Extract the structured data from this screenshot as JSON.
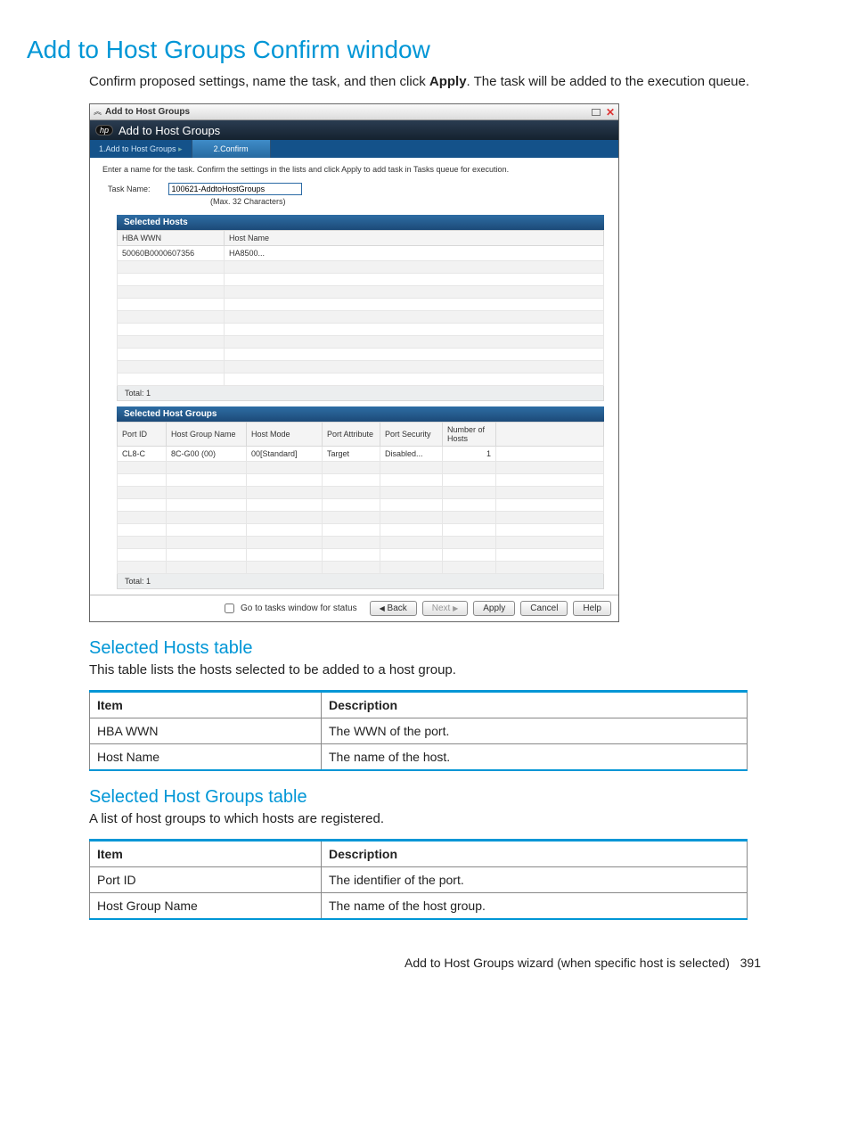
{
  "heading": "Add to Host Groups Confirm window",
  "intro_pre": "Confirm proposed settings, name the task, and then click ",
  "intro_bold": "Apply",
  "intro_post": ". The task will be added to the execution queue.",
  "win": {
    "outerTitle": "Add to Host Groups",
    "innerTitle": "Add to Host Groups",
    "step1": "1.Add to Host Groups",
    "step2": "2.Confirm",
    "instruction": "Enter a name for the task. Confirm the settings in the lists and click Apply to add task in Tasks queue for execution.",
    "taskLabel": "Task Name:",
    "taskValue": "100621-AddtoHostGroups",
    "taskHint": "(Max. 32 Characters)",
    "hostsPanel": "Selected Hosts",
    "hostsCols": [
      "HBA WWN",
      "Host Name"
    ],
    "hostsRow": [
      "50060B0000607356",
      "HA8500..."
    ],
    "hostsTotal": "Total: 1",
    "groupsPanel": "Selected Host Groups",
    "groupsCols": [
      "Port ID",
      "Host Group Name",
      "Host Mode",
      "Port Attribute",
      "Port Security",
      "Number of Hosts"
    ],
    "groupsRow": [
      "CL8-C",
      "8C-G00 (00)",
      "00[Standard]",
      "Target",
      "Disabled...",
      "1"
    ],
    "groupsTotal": "Total: 1",
    "cbLabel": "Go to tasks window for status",
    "btnBack": "Back",
    "btnNext": "Next",
    "btnApply": "Apply",
    "btnCancel": "Cancel",
    "btnHelp": "Help"
  },
  "sec1": {
    "title": "Selected Hosts table",
    "desc": "This table lists the hosts selected to be added to a host group.",
    "h1": "Item",
    "h2": "Description",
    "r1c1": "HBA WWN",
    "r1c2": "The WWN of the port.",
    "r2c1": "Host Name",
    "r2c2": "The name of the host."
  },
  "sec2": {
    "title": "Selected Host Groups table",
    "desc": "A list of host groups to which hosts are registered.",
    "h1": "Item",
    "h2": "Description",
    "r1c1": "Port ID",
    "r1c2": "The identifier of the port.",
    "r2c1": "Host Group Name",
    "r2c2": "The name of the host group."
  },
  "footer_text": "Add to Host Groups wizard (when specific host is selected)",
  "footer_page": "391"
}
